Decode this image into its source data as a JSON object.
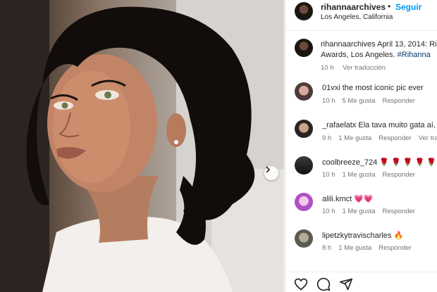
{
  "post": {
    "username": "rihannaarchives",
    "dot": "•",
    "follow_label": "Seguir",
    "location": "Los Angeles, California"
  },
  "caption": {
    "username": "rihannaarchives",
    "text": " April 13, 2014: Ri",
    "text_line2": "Awards, Los Angeles. ",
    "hashtag": "#Rihanna",
    "time": "10 h",
    "translate": "Ver traducción"
  },
  "comments": [
    {
      "username": "01vxi",
      "text": " the most iconic pic ever",
      "time": "10 h",
      "likes": "5 Me gusta",
      "reply": "Responder",
      "extra": ""
    },
    {
      "username": "_rafaelatx",
      "text": " Ela tava muito gata aí,",
      "time": "9 h",
      "likes": "1 Me gusta",
      "reply": "Responder",
      "extra": "Ver tra"
    },
    {
      "username": "coolbreeze_724",
      "text": " 🌹 🌹 🌹 🌹 🌹",
      "time": "10 h",
      "likes": "1 Me gusta",
      "reply": "Responder",
      "extra": ""
    },
    {
      "username": "alili.kmct",
      "text": " 💗💗",
      "time": "10 h",
      "likes": "1 Me gusta",
      "reply": "Responder",
      "extra": ""
    },
    {
      "username": "lipetzkytravischarles",
      "text": " 🔥",
      "time": "8 h",
      "likes": "1 Me gusta",
      "reply": "Responder",
      "extra": ""
    }
  ],
  "icons": {
    "next": "chevron-right-icon",
    "like": "heart-icon",
    "comment": "comment-icon",
    "share": "share-icon"
  },
  "colors": {
    "accent": "#0095f6",
    "hashtag": "#00376b",
    "muted": "#737373"
  }
}
